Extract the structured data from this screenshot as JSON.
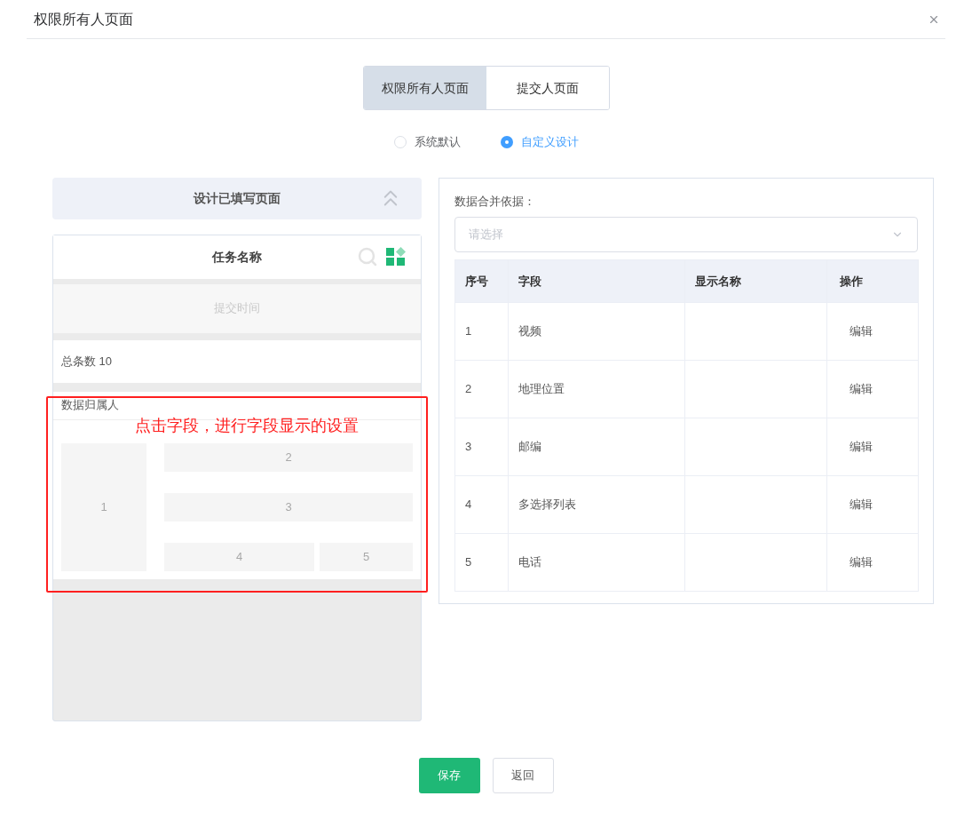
{
  "dialog": {
    "title": "权限所有人页面"
  },
  "tabs": [
    {
      "label": "权限所有人页面",
      "selected": true
    },
    {
      "label": "提交人页面",
      "selected": false
    }
  ],
  "mode_options": [
    {
      "label": "系统默认",
      "selected": false
    },
    {
      "label": "自定义设计",
      "selected": true
    }
  ],
  "designer": {
    "header": "设计已填写页面",
    "preview": {
      "title": "任务名称",
      "subtitle": "提交时间",
      "total": "总条数 10",
      "card": {
        "title": "数据归属人",
        "slots": [
          "1",
          "2",
          "3",
          "4",
          "5"
        ]
      }
    }
  },
  "annotation": "点击字段，进行字段显示的设置",
  "merge": {
    "label": "数据合并依据：",
    "placeholder": "请选择"
  },
  "table": {
    "columns": [
      "序号",
      "字段",
      "显示名称",
      "操作"
    ],
    "rows": [
      {
        "index": "1",
        "field": "视频",
        "action": "编辑"
      },
      {
        "index": "2",
        "field": "地理位置",
        "action": "编辑"
      },
      {
        "index": "3",
        "field": "邮编",
        "action": "编辑"
      },
      {
        "index": "4",
        "field": "多选择列表",
        "action": "编辑"
      },
      {
        "index": "5",
        "field": "电话",
        "action": "编辑"
      }
    ]
  },
  "buttons": [
    {
      "label": "保存",
      "kind": "primary"
    },
    {
      "label": "返回",
      "kind": "default"
    }
  ]
}
